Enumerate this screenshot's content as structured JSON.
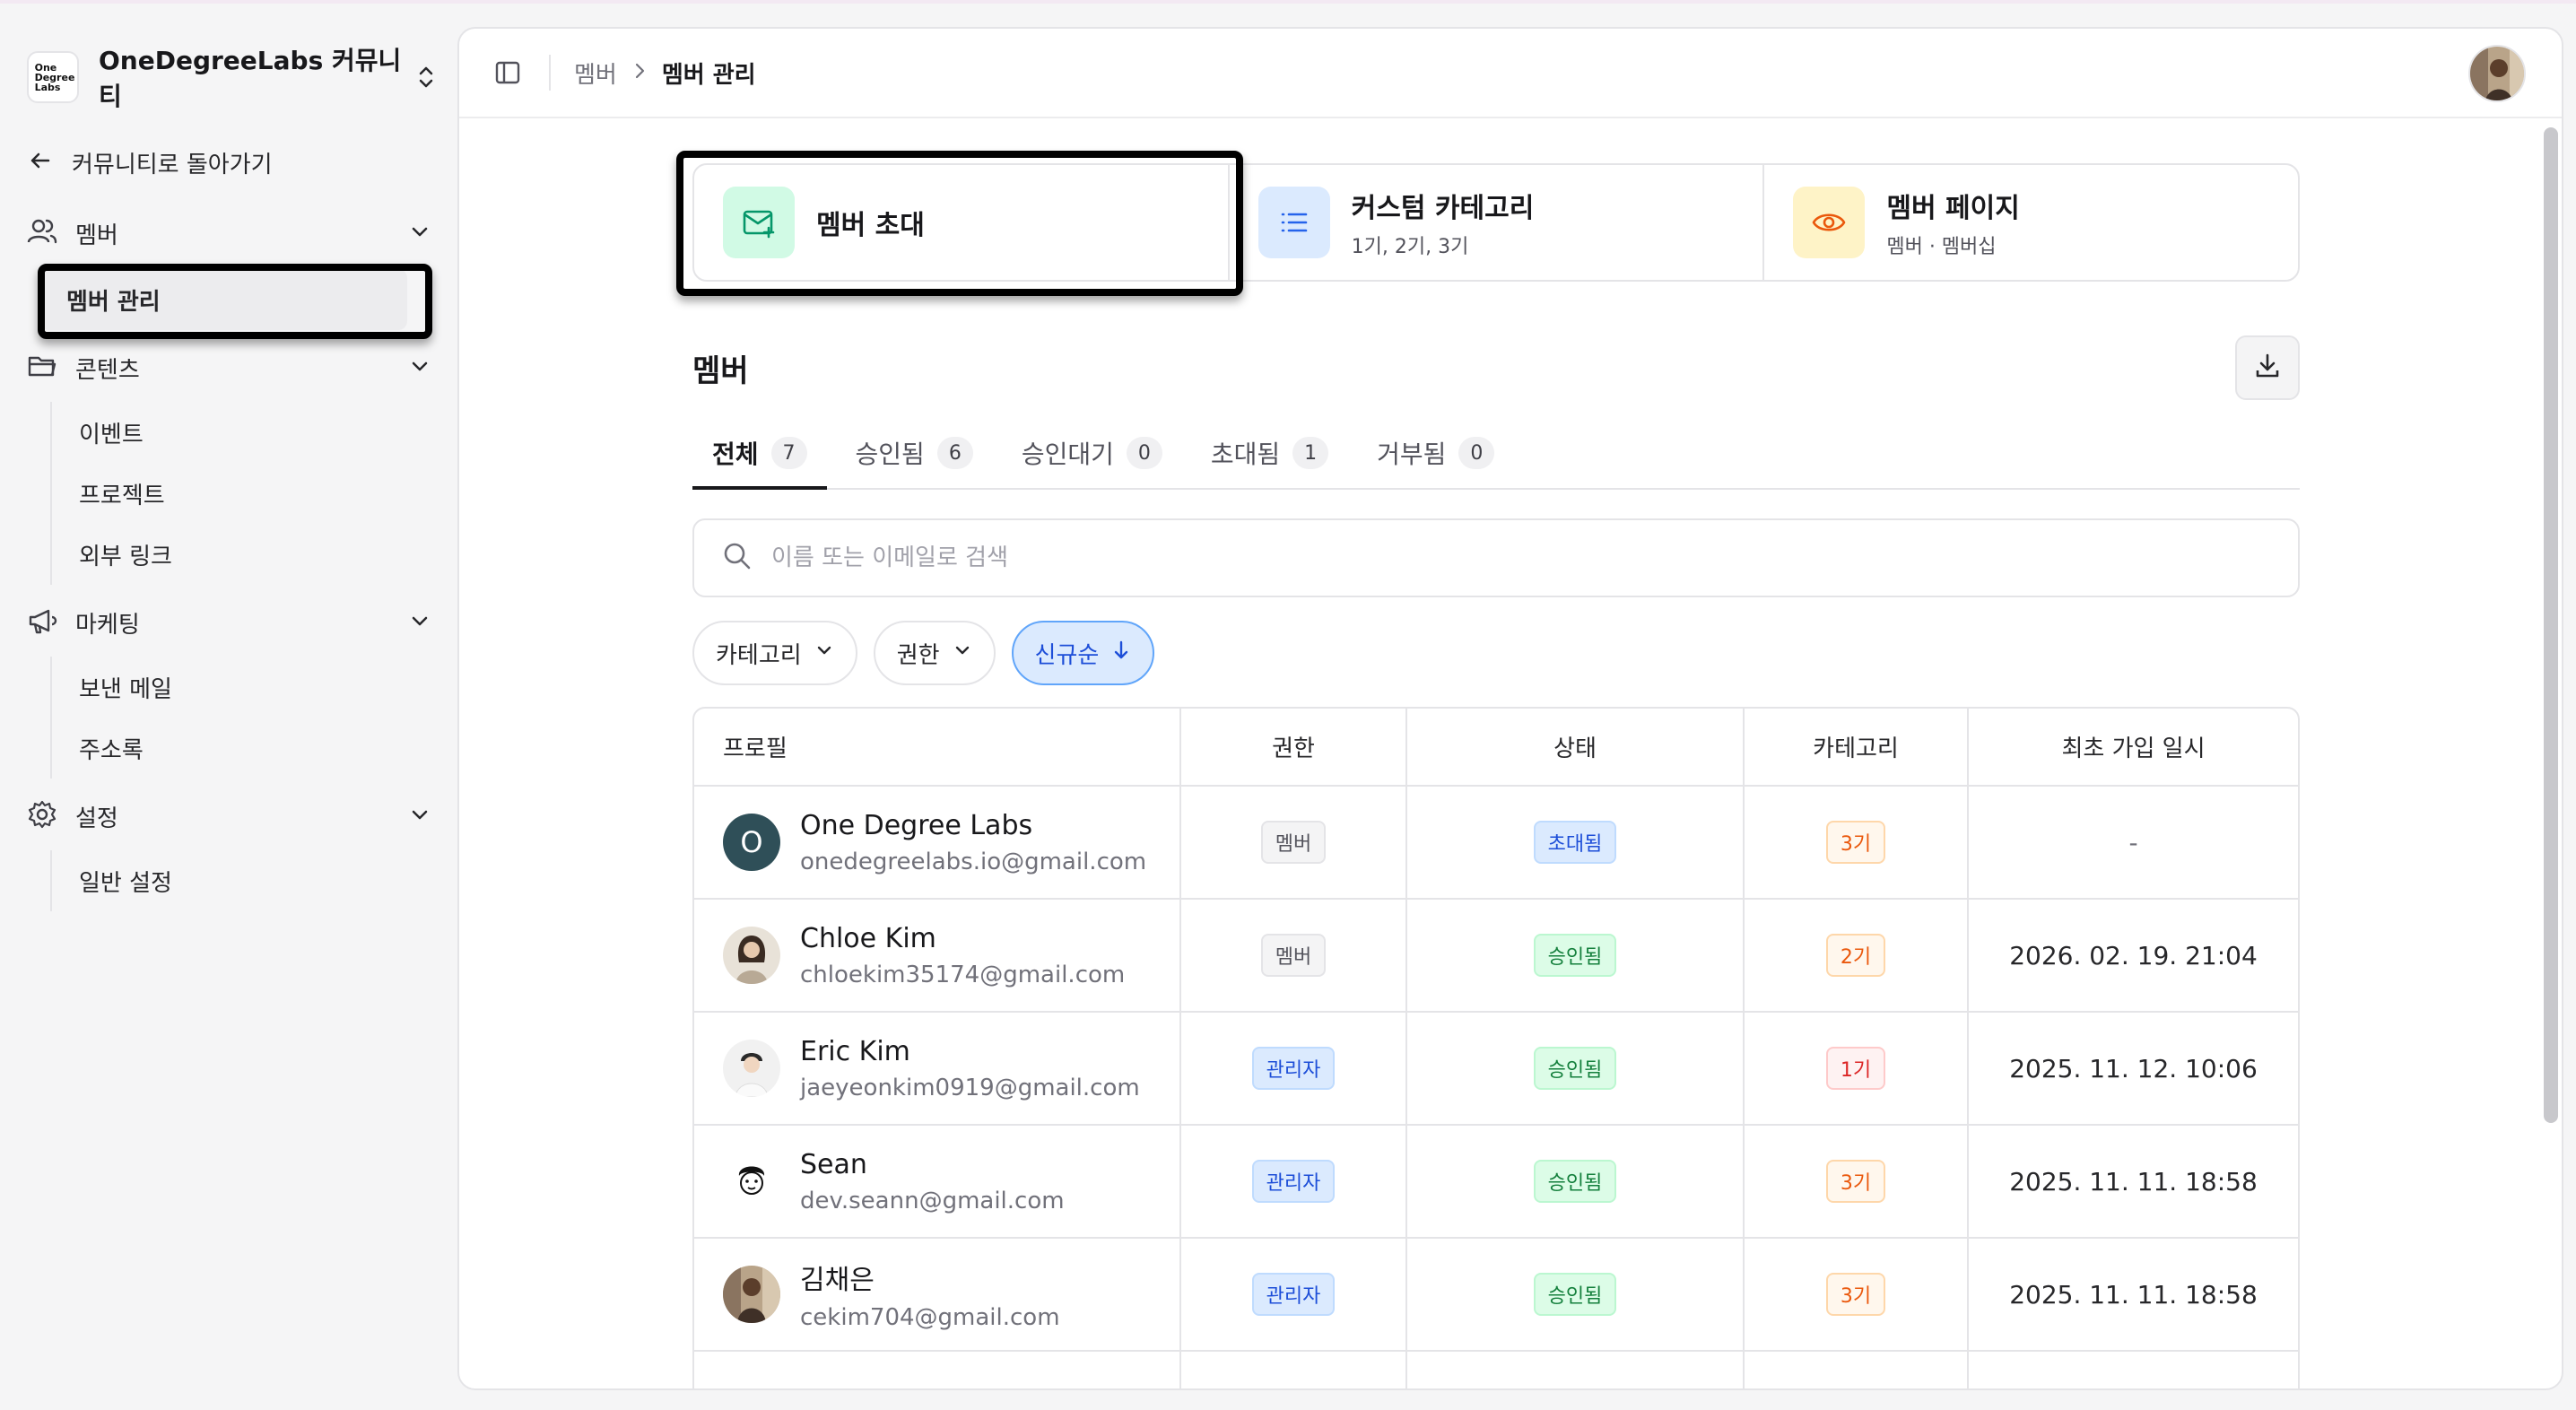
{
  "workspace": {
    "logo_text": "One Degree Labs",
    "name": "OneDegreeLabs 커뮤니티"
  },
  "sidebar": {
    "back_label": "커뮤니티로 돌아가기",
    "groups": [
      {
        "label": "멤버",
        "items": [
          "멤버 관리"
        ]
      },
      {
        "label": "콘텐츠",
        "items": [
          "이벤트",
          "프로젝트",
          "외부 링크"
        ]
      },
      {
        "label": "마케팅",
        "items": [
          "보낸 메일",
          "주소록"
        ]
      },
      {
        "label": "설정",
        "items": [
          "일반 설정"
        ]
      }
    ]
  },
  "topbar": {
    "crumb_parent": "멤버",
    "crumb_current": "멤버 관리"
  },
  "cards": [
    {
      "title": "멤버 초대",
      "subtitle": ""
    },
    {
      "title": "커스텀 카테고리",
      "subtitle": "1기, 2기, 3기"
    },
    {
      "title": "멤버 페이지",
      "subtitle": "멤버 · 멤버십"
    }
  ],
  "section": {
    "title": "멤버"
  },
  "tabs": [
    {
      "label": "전체",
      "count": "7"
    },
    {
      "label": "승인됨",
      "count": "6"
    },
    {
      "label": "승인대기",
      "count": "0"
    },
    {
      "label": "초대됨",
      "count": "1"
    },
    {
      "label": "거부됨",
      "count": "0"
    }
  ],
  "search": {
    "placeholder": "이름 또는 이메일로 검색"
  },
  "filters": {
    "category": "카테고리",
    "role": "권한",
    "sort": "신규순"
  },
  "table": {
    "headers": {
      "profile": "프로필",
      "role": "권한",
      "status": "상태",
      "category": "카테고리",
      "joined": "최초 가입 일시"
    },
    "rows": [
      {
        "name": "One Degree Labs",
        "email": "onedegreelabs.io@gmail.com",
        "avatar_letter": "O",
        "role": "멤버",
        "status": "초대됨",
        "category": "3기",
        "joined": "-"
      },
      {
        "name": "Chloe Kim",
        "email": "chloekim35174@gmail.com",
        "role": "멤버",
        "status": "승인됨",
        "category": "2기",
        "joined": "2026. 02. 19. 21:04"
      },
      {
        "name": "Eric Kim",
        "email": "jaeyeonkim0919@gmail.com",
        "role": "관리자",
        "status": "승인됨",
        "category": "1기",
        "joined": "2025. 11. 12. 10:06"
      },
      {
        "name": "Sean",
        "email": "dev.seann@gmail.com",
        "role": "관리자",
        "status": "승인됨",
        "category": "3기",
        "joined": "2025. 11. 11. 18:58"
      },
      {
        "name": "김채은",
        "email": "cekim704@gmail.com",
        "role": "관리자",
        "status": "승인됨",
        "category": "3기",
        "joined": "2025. 11. 11. 18:58"
      }
    ]
  },
  "colors": {
    "accent": "#1d4ed8",
    "approved": "#15803d",
    "category": "#ea580c"
  }
}
